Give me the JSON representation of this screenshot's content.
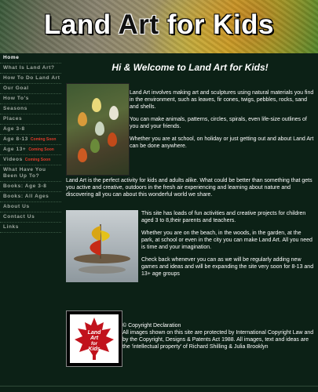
{
  "banner": {
    "title_part1": "Land ",
    "title_part2": "Art",
    "title_part3": " for Kids"
  },
  "nav": [
    {
      "label": "Home",
      "soon": ""
    },
    {
      "label": "What Is Land Art?",
      "soon": ""
    },
    {
      "label": "How To Do Land Art",
      "soon": ""
    },
    {
      "label": "Our Goal",
      "soon": ""
    },
    {
      "label": "How To's",
      "soon": ""
    },
    {
      "label": "Seasons",
      "soon": ""
    },
    {
      "label": "Places",
      "soon": ""
    },
    {
      "label": "Age 3-8",
      "soon": ""
    },
    {
      "label": "Age 8-13",
      "soon": "Coming Soon"
    },
    {
      "label": "Age 13+",
      "soon": "Coming Soon"
    },
    {
      "label": "Videos",
      "soon": "Coming Soon"
    },
    {
      "label": "What Have You Been Up To?",
      "soon": ""
    },
    {
      "label": "Books: Age 3-8",
      "soon": ""
    },
    {
      "label": "Books: All Ages",
      "soon": ""
    },
    {
      "label": "About Us",
      "soon": ""
    },
    {
      "label": "Contact Us",
      "soon": ""
    },
    {
      "label": "Links",
      "soon": ""
    }
  ],
  "main": {
    "heading": "Hi & Welcome to Land Art for Kids!",
    "para1": "Land Art involves making art and sculptures using natural materials you find in the environment, such as leaves, fir cones, twigs, pebbles, rocks, sand and shells.",
    "para2": "You can make animals, patterns, circles, spirals, even life-size outlines of you and your friends.",
    "para3": "Whether you are at school, on holiday or just getting out and about Land Art can be done anywhere.",
    "para4": "Land Art is the perfect activity for kids and adults alike. What could be better than something that gets you active and creative, outdoors in the fresh air experiencing and learning about nature and discovering all you can about this wonderful world we share.",
    "para5": "This site has loads of fun activities and creative projects for children aged 3 to 8,their parents and teachers.",
    "para6": "Whether you are on the beach, in the woods, in the garden, at the park, at school or even in the city you can make Land Art. All you need is time and your imagination.",
    "para7": "Check back whenever you can as we will be regularly adding new games and ideas and will be expanding the site very soon for 8-13 and 13+ age groups",
    "copyright": "© Copyright Declaration\nAll images shown on this site are protected by International Copyright Law and by the Copyright, Designs & Patents Act 1988. All images, text and ideas are the 'intellectual property' of Richard Shilling & Julia Brooklyn",
    "logo_text": [
      "Land",
      "Art",
      "for",
      "Kids"
    ]
  },
  "colors": {
    "background": "#0c2116",
    "accent_red": "#e03a2a",
    "nav_text": "#9fa8a0"
  }
}
